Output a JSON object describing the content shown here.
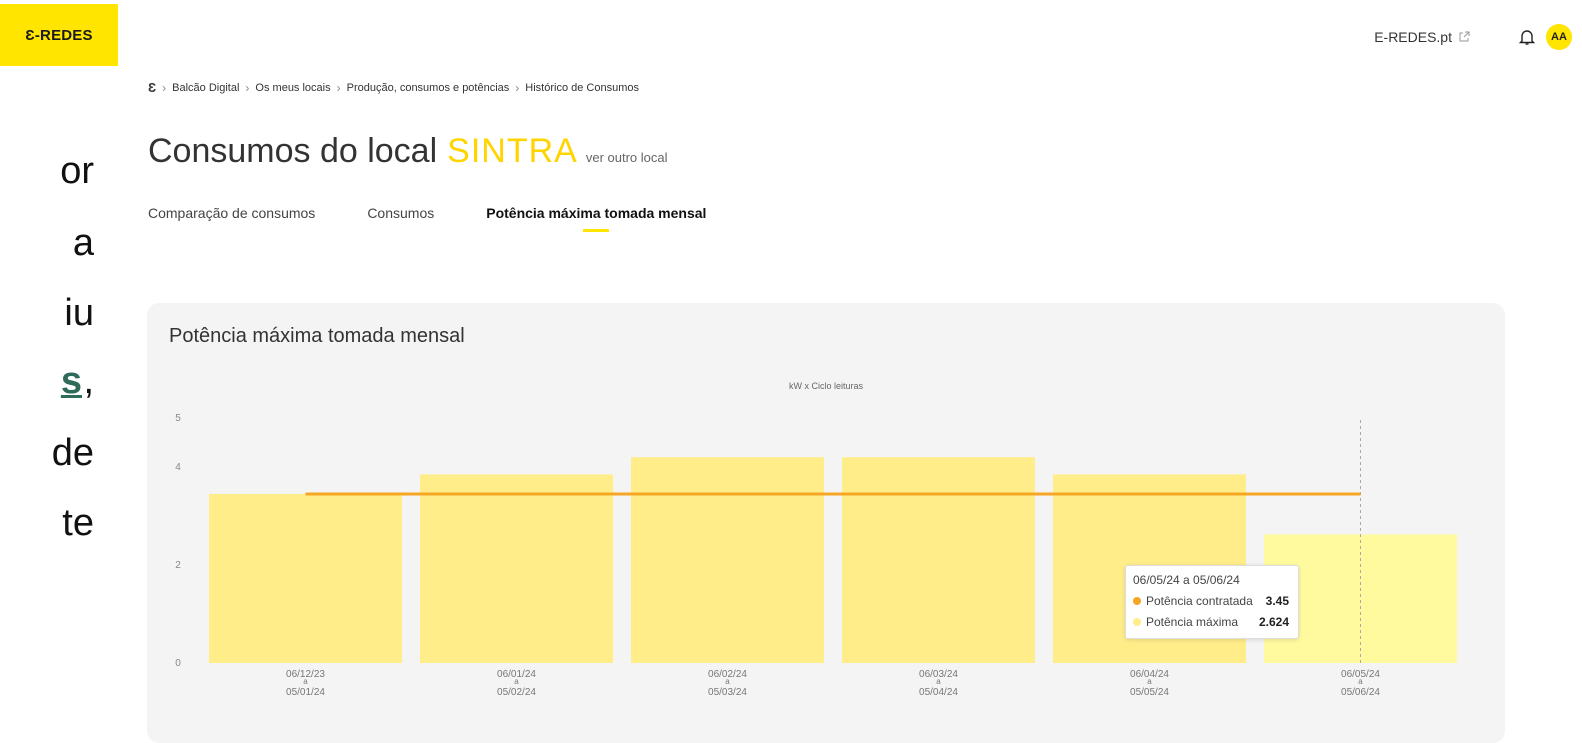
{
  "brand": {
    "logo_text": "Ɛ-REDES"
  },
  "slide_fragments": [
    "or",
    "a",
    "iu",
    "s",
    ",",
    "de",
    "te"
  ],
  "topbar": {
    "external_link": "E-REDES.pt",
    "avatar": "AA"
  },
  "breadcrumb": [
    "Balcão Digital",
    "Os meus locais",
    "Produção, consumos e potências",
    "Histórico de Consumos"
  ],
  "header": {
    "title": "Consumos do local",
    "local": "SINTRA",
    "other_local_link": "ver outro local"
  },
  "tabs": [
    {
      "label": "Comparação de consumos",
      "active": false
    },
    {
      "label": "Consumos",
      "active": false
    },
    {
      "label": "Potência máxima tomada mensal",
      "active": true
    }
  ],
  "card": {
    "title": "Potência máxima tomada mensal"
  },
  "chart_data": {
    "type": "bar",
    "title": "kW x Ciclo leituras",
    "categories": [
      [
        "06/12/23",
        "a",
        "05/01/24"
      ],
      [
        "06/01/24",
        "a",
        "05/02/24"
      ],
      [
        "06/02/24",
        "a",
        "05/03/24"
      ],
      [
        "06/03/24",
        "a",
        "05/04/24"
      ],
      [
        "06/04/24",
        "a",
        "05/05/24"
      ],
      [
        "06/05/24",
        "a",
        "05/06/24"
      ]
    ],
    "yticks": [
      0,
      2,
      4,
      5
    ],
    "ylim": [
      0,
      5
    ],
    "series": [
      {
        "name": "Potência máxima",
        "type": "bar",
        "color": "#FFED8A",
        "highlight_color": "#FFFA9E",
        "values": [
          3.45,
          3.85,
          4.2,
          4.2,
          3.85,
          2.624
        ]
      },
      {
        "name": "Potência contratada",
        "type": "line",
        "color": "#F5A623",
        "values": [
          3.45,
          3.45,
          3.45,
          3.45,
          3.45,
          3.45
        ]
      }
    ],
    "highlighted_index": 5
  },
  "tooltip": {
    "title": "06/05/24 a 05/06/24",
    "rows": [
      {
        "label": "Potência contratada",
        "value": "3.45",
        "color": "#F5A623"
      },
      {
        "label": "Potência máxima",
        "value": "2.624",
        "color": "#FFED8A"
      }
    ]
  }
}
